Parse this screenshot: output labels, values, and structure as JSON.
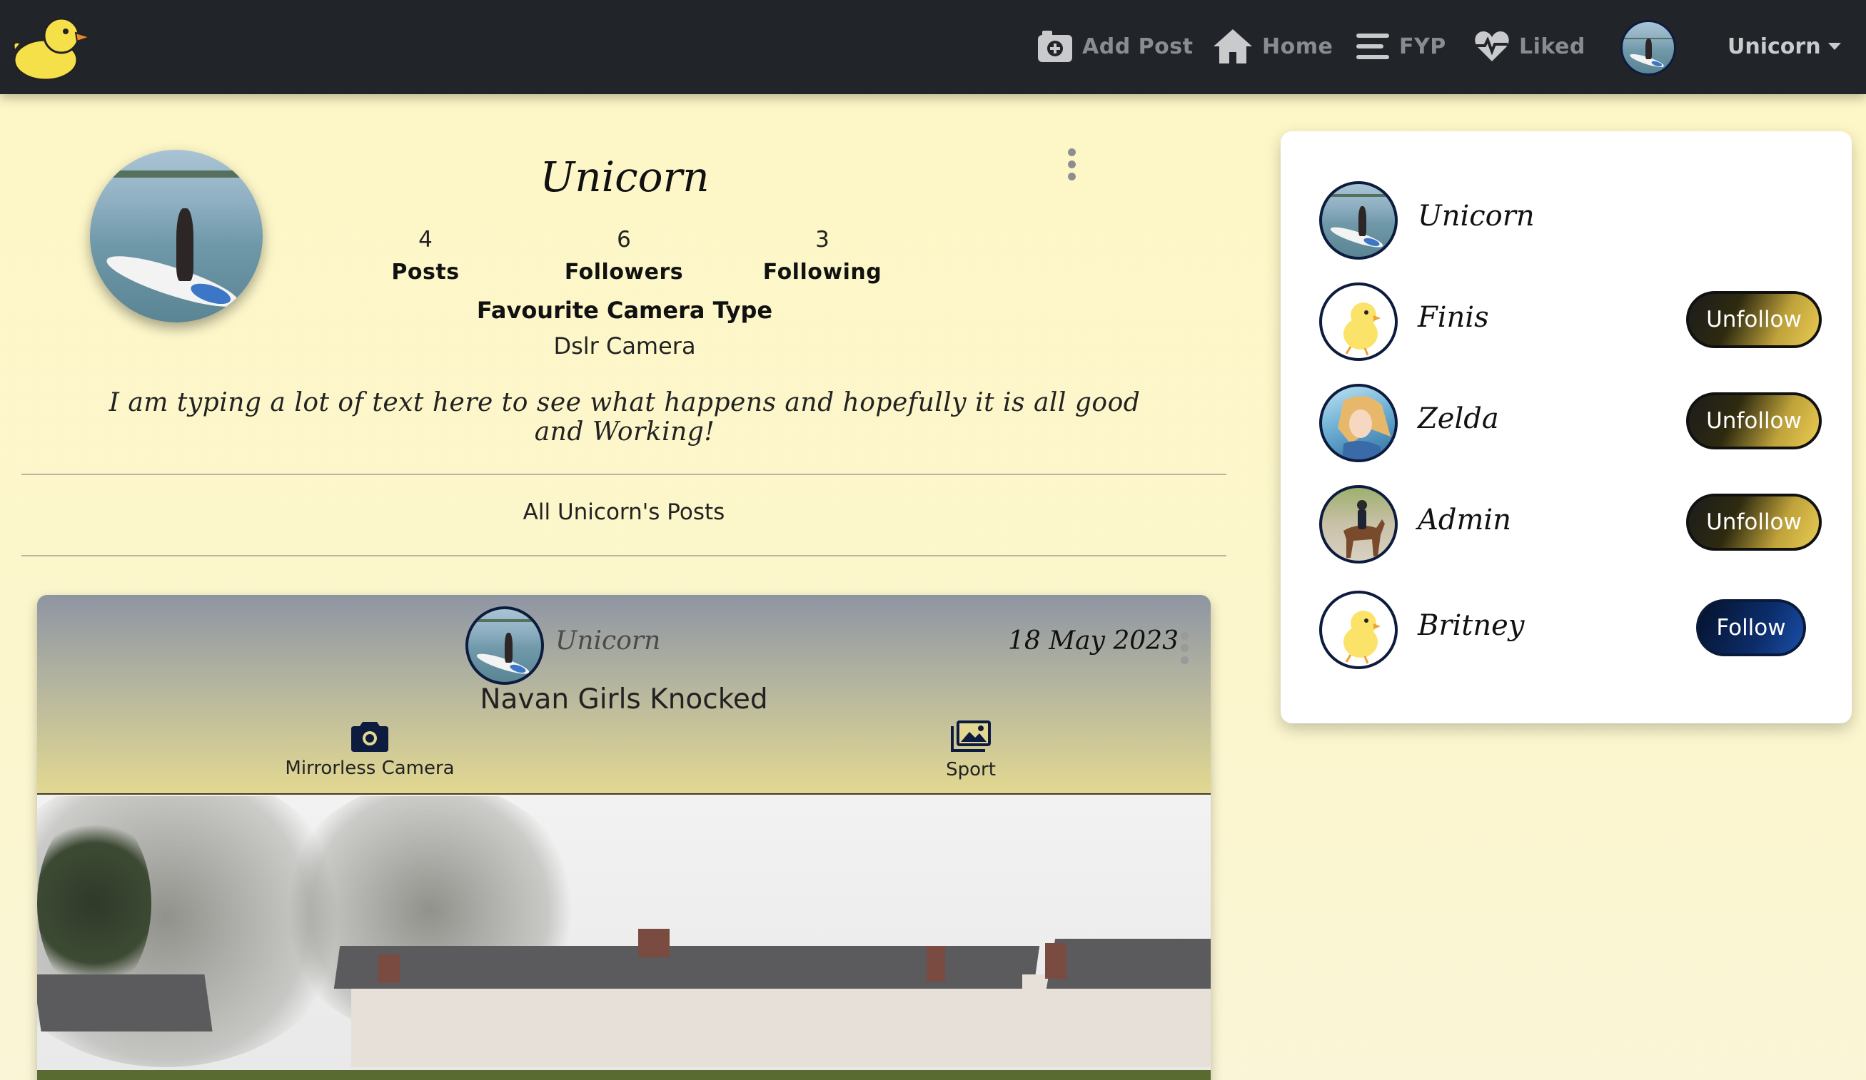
{
  "nav": {
    "add_post": "Add Post",
    "home": "Home",
    "fyp": "FYP",
    "liked": "Liked",
    "user_menu": "Unicorn"
  },
  "profile": {
    "name": "Unicorn",
    "stats": [
      {
        "value": "4",
        "label": "Posts"
      },
      {
        "value": "6",
        "label": "Followers"
      },
      {
        "value": "3",
        "label": "Following"
      }
    ],
    "favourite_label": "Favourite Camera Type",
    "favourite_value": "Dslr Camera",
    "bio": "I am typing a lot of text here to see what happens and hopefully it is all good and Working!"
  },
  "posts_heading": "All Unicorn's Posts",
  "post": {
    "username": "Unicorn",
    "date": "18 May 2023",
    "title": "Navan Girls Knocked",
    "camera": "Mirrorless Camera",
    "category": "Sport"
  },
  "sidebar": {
    "users": [
      {
        "name": "Unicorn",
        "action": ""
      },
      {
        "name": "Finis",
        "action": "Unfollow"
      },
      {
        "name": "Zelda",
        "action": "Unfollow"
      },
      {
        "name": "Admin",
        "action": "Unfollow"
      },
      {
        "name": "Britney",
        "action": "Follow"
      }
    ]
  },
  "colors": {
    "navbar": "#212529",
    "page_background": "#fdf7c6",
    "follow_button": "#0c2d6b",
    "unfollow_button": "#bfa23a"
  }
}
